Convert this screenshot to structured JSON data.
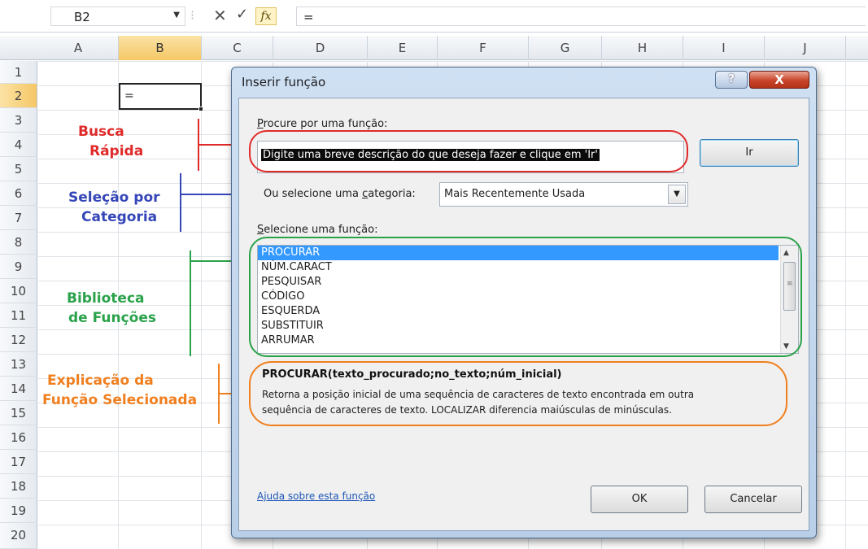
{
  "formula_bar": {
    "name_box": "B2",
    "cancel_glyph": "✕",
    "enter_glyph": "✓",
    "fx_label": "fx",
    "content": "="
  },
  "columns": [
    "A",
    "B",
    "C",
    "D",
    "E",
    "F",
    "G",
    "H",
    "I",
    "J"
  ],
  "rows": [
    "1",
    "2",
    "3",
    "4",
    "5",
    "6",
    "7",
    "8",
    "9",
    "10",
    "11",
    "12",
    "13",
    "14",
    "15",
    "16",
    "17",
    "18",
    "19",
    "20"
  ],
  "active_cell": {
    "value": "="
  },
  "annotations": {
    "busca": [
      "Busca",
      "Rápida"
    ],
    "selecao": [
      "Seleção por",
      "Categoria"
    ],
    "biblioteca": [
      "Biblioteca",
      "de Funções"
    ],
    "explicacao": [
      "Explicação da",
      "Função Selecionada"
    ]
  },
  "annotation_colors": {
    "red": "#e02a2a",
    "blue": "#3546b8",
    "green": "#2aa24a",
    "orange": "#f07f1f"
  },
  "dialog": {
    "title": "Inserir função",
    "help_glyph": "?",
    "close_glyph": "X",
    "search_label_access": "P",
    "search_label_rest": "rocure por uma função:",
    "search_value": "Digite uma breve descrição do que deseja fazer e clique em 'Ir'",
    "go_button": "Ir",
    "category_label_pre": "Ou selecione uma ",
    "category_label_access": "c",
    "category_label_post": "ategoria:",
    "category_value": "Mais Recentemente Usada",
    "function_label_access": "S",
    "function_label_rest": "elecione uma função:",
    "functions": [
      "PROCURAR",
      "NÚM.CARACT",
      "PESQUISAR",
      "CÓDIGO",
      "ESQUERDA",
      "SUBSTITUIR",
      "ARRUMAR"
    ],
    "selected_index": 0,
    "syntax": "PROCURAR(texto_procurado;no_texto;núm_inicial)",
    "description_line1": "Retorna a posição inicial de uma sequência de caracteres de texto encontrada em outra",
    "description_line2": "sequência de caracteres de texto. LOCALIZAR diferencia maiúsculas de minúsculas.",
    "help_link": "Ajuda sobre esta função",
    "ok_button": "OK",
    "cancel_button": "Cancelar"
  }
}
